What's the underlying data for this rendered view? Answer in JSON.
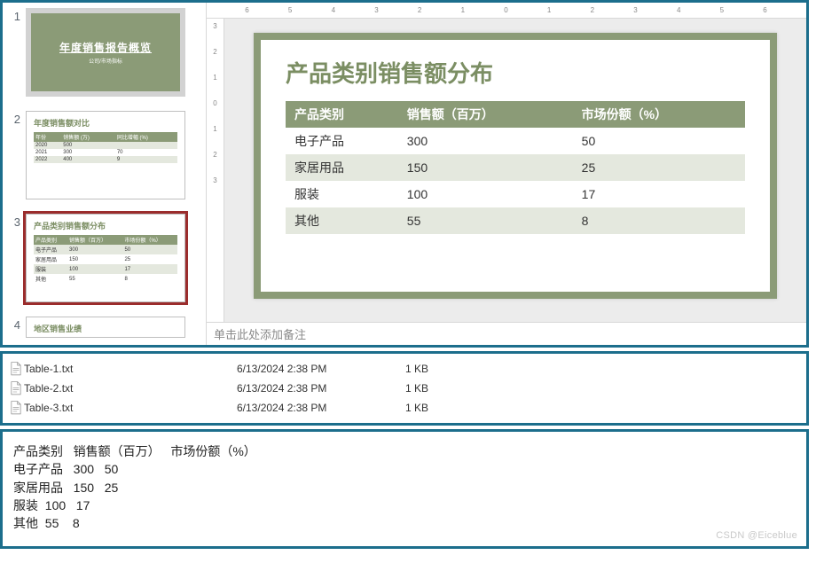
{
  "chart_data": {
    "type": "table",
    "title": "产品类别销售额分布",
    "columns": [
      "产品类别",
      "销售额（百万）",
      "市场份额（%）"
    ],
    "rows": [
      [
        "电子产品",
        300,
        50
      ],
      [
        "家居用品",
        150,
        25
      ],
      [
        "服装",
        100,
        17
      ],
      [
        "其他",
        55,
        8
      ]
    ]
  },
  "thumbnails": [
    {
      "num": "1",
      "kind": "title",
      "title": "年度销售报告概览",
      "subtitle": "公司/市场指标"
    },
    {
      "num": "2",
      "kind": "table",
      "title": "年度销售额对比",
      "headers": [
        "年份",
        "销售额 (万)",
        "同比增幅 (%)"
      ],
      "rows": [
        [
          "2020",
          "500",
          ""
        ],
        [
          "2021",
          "300",
          "70"
        ],
        [
          "2022",
          "400",
          "9"
        ]
      ]
    },
    {
      "num": "3",
      "kind": "table",
      "title": "产品类别销售额分布",
      "headers": [
        "产品类别",
        "销售额（百万）",
        "市场份额（%）"
      ],
      "rows": [
        [
          "电子产品",
          "300",
          "50"
        ],
        [
          "家居用品",
          "150",
          "25"
        ],
        [
          "服装",
          "100",
          "17"
        ],
        [
          "其他",
          "55",
          "8"
        ]
      ],
      "selected": true
    },
    {
      "num": "4",
      "kind": "table",
      "title": "地区销售业绩",
      "headers": [],
      "rows": []
    }
  ],
  "main_slide": {
    "title": "产品类别销售额分布",
    "headers": [
      "产品类别",
      "销售额（百万）",
      "市场份额（%）"
    ],
    "rows": [
      [
        "电子产品",
        "300",
        "50"
      ],
      [
        "家居用品",
        "150",
        "25"
      ],
      [
        "服装",
        "100",
        "17"
      ],
      [
        "其他",
        "55",
        "8"
      ]
    ]
  },
  "h_ruler_labels": [
    "6",
    "5",
    "4",
    "3",
    "2",
    "1",
    "0",
    "1",
    "2",
    "3",
    "4",
    "5",
    "6"
  ],
  "v_ruler_labels": [
    "3",
    "2",
    "1",
    "0",
    "1",
    "2",
    "3"
  ],
  "notes_placeholder": "单击此处添加备注",
  "files": [
    {
      "name": "Table-1.txt",
      "date": "6/13/2024 2:38 PM",
      "size": "1 KB"
    },
    {
      "name": "Table-2.txt",
      "date": "6/13/2024 2:38 PM",
      "size": "1 KB"
    },
    {
      "name": "Table-3.txt",
      "date": "6/13/2024 2:38 PM",
      "size": "1 KB"
    }
  ],
  "tsv": {
    "header": "产品类别   销售额（百万）   市场份额（%）",
    "lines": [
      "电子产品   300   50",
      "家居用品   150   25",
      "服装  100   17",
      "其他  55    8"
    ]
  },
  "watermark": "CSDN @Eiceblue"
}
